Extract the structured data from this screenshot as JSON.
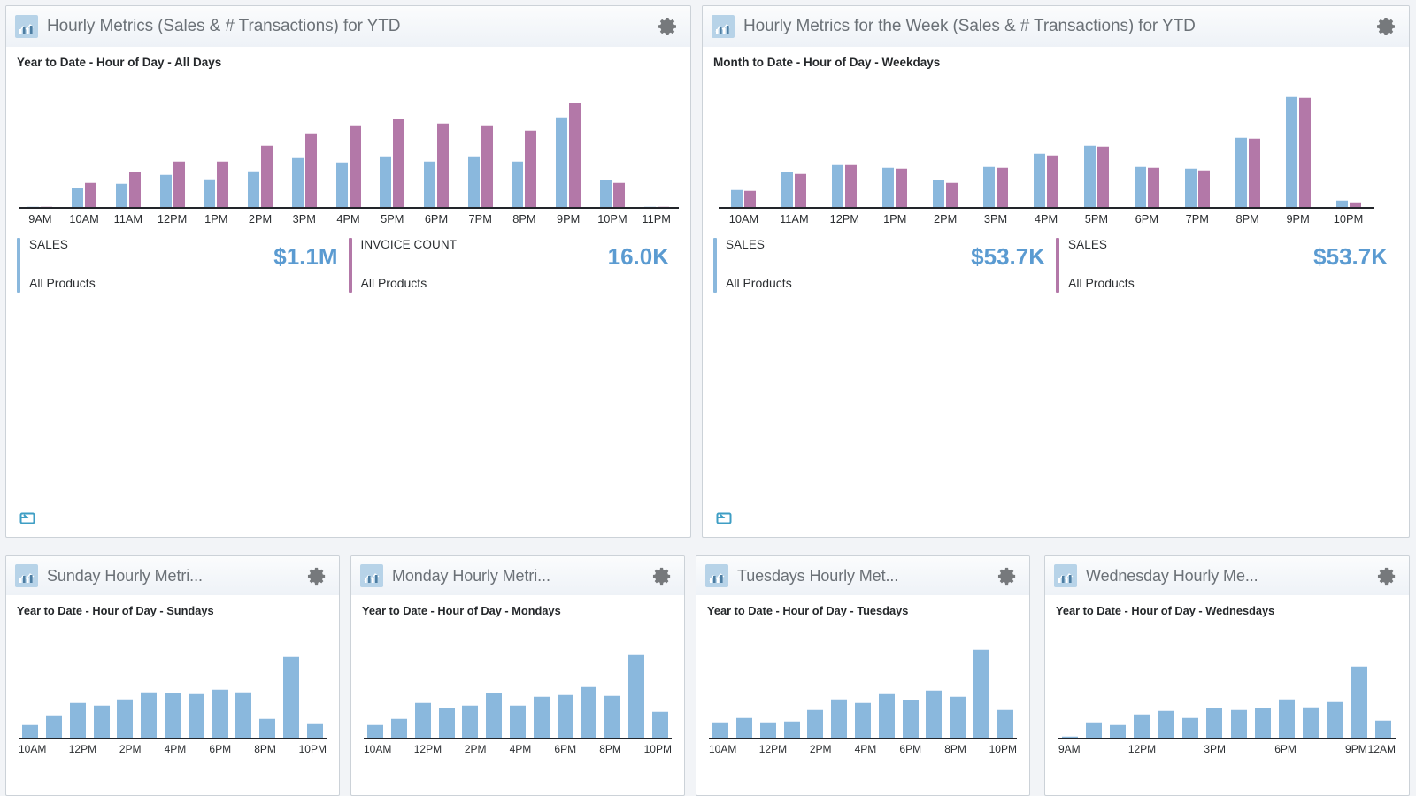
{
  "theme": {
    "series_blue": "#8ab8dd",
    "series_purple": "#b378a8",
    "kpi_value_color": "#5b9bd1",
    "panel_border": "#ccd2d8",
    "page_background": "#f2f4f7",
    "title_color": "#6b7177"
  },
  "panels": [
    {
      "id": "hourly-metrics-ytd",
      "icon": "bar-chart-icon",
      "gear": "gear-icon",
      "title": "Hourly Metrics (Sales & # Transactions) for YTD",
      "subtitle": "Year to Date - Hour of Day - All Days",
      "resize_handle": "resize-handle-icon",
      "kpis": [
        {
          "label": "SALES",
          "sub": "All Products",
          "value": "$1.1M",
          "accent": "#8ab8dd"
        },
        {
          "label": "INVOICE COUNT",
          "sub": "All Products",
          "value": "16.0K",
          "accent": "#b378a8"
        }
      ]
    },
    {
      "id": "hourly-metrics-week-ytd",
      "icon": "bar-chart-icon",
      "gear": "gear-icon",
      "title": "Hourly Metrics for the Week (Sales & # Transactions) for YTD",
      "subtitle": "Month to Date - Hour of Day - Weekdays",
      "resize_handle": "resize-handle-icon",
      "kpis": [
        {
          "label": "SALES",
          "sub": "All Products",
          "value": "$53.7K",
          "accent": "#8ab8dd"
        },
        {
          "label": "SALES",
          "sub": "All Products",
          "value": "$53.7K",
          "accent": "#b378a8"
        }
      ]
    },
    {
      "id": "sunday-hourly-metrics",
      "icon": "bar-chart-icon",
      "gear": "gear-icon",
      "title": "Sunday Hourly Metri...",
      "subtitle": "Year to Date - Hour of Day - Sundays",
      "kpis": []
    },
    {
      "id": "monday-hourly-metrics",
      "icon": "bar-chart-icon",
      "gear": "gear-icon",
      "title": "Monday Hourly Metri...",
      "subtitle": "Year to Date - Hour of Day - Mondays",
      "kpis": []
    },
    {
      "id": "tuesdays-hourly-metrics",
      "icon": "bar-chart-icon",
      "gear": "gear-icon",
      "title": "Tuesdays Hourly Met...",
      "subtitle": "Year to Date - Hour of Day - Tuesdays",
      "kpis": []
    },
    {
      "id": "wednesday-hourly-metrics",
      "icon": "bar-chart-icon",
      "gear": "gear-icon",
      "title": "Wednesday Hourly Me...",
      "subtitle": "Year to Date - Hour of Day - Wednesdays",
      "kpis": []
    }
  ],
  "chart_data": [
    {
      "id": "hourly-metrics-ytd",
      "type": "bar",
      "title": "Year to Date - Hour of Day - All Days",
      "xlabel": "Hour of Day",
      "ylabel": "",
      "grid": false,
      "legend_position": "below",
      "categories": [
        "9AM",
        "10AM",
        "11AM",
        "12PM",
        "1PM",
        "2PM",
        "3PM",
        "4PM",
        "5PM",
        "6PM",
        "7PM",
        "8PM",
        "9PM",
        "10PM",
        "11PM"
      ],
      "tick_labels": [
        "9AM",
        "10AM",
        "11AM",
        "12PM",
        "1PM",
        "2PM",
        "3PM",
        "4PM",
        "5PM",
        "6PM",
        "7PM",
        "8PM",
        "9PM",
        "10PM",
        "11PM"
      ],
      "ylim": [
        0,
        100
      ],
      "series": [
        {
          "name": "SALES",
          "color": "#8ab8dd",
          "values": [
            0,
            17,
            21,
            29,
            25,
            32,
            44,
            40,
            45,
            41,
            45,
            41,
            80,
            24,
            0
          ]
        },
        {
          "name": "INVOICE COUNT",
          "color": "#b378a8",
          "values": [
            0,
            22,
            31,
            41,
            41,
            55,
            66,
            73,
            78,
            74,
            73,
            68,
            92,
            22,
            0
          ]
        }
      ]
    },
    {
      "id": "hourly-metrics-week-ytd",
      "type": "bar",
      "title": "Month to Date - Hour of Day - Weekdays",
      "xlabel": "Hour of Day",
      "ylabel": "",
      "grid": false,
      "legend_position": "below",
      "categories": [
        "10AM",
        "11AM",
        "12PM",
        "1PM",
        "2PM",
        "3PM",
        "4PM",
        "5PM",
        "6PM",
        "7PM",
        "8PM",
        "9PM",
        "10PM"
      ],
      "tick_labels": [
        "10AM",
        "11AM",
        "12PM",
        "1PM",
        "2PM",
        "3PM",
        "4PM",
        "5PM",
        "6PM",
        "7PM",
        "8PM",
        "9PM",
        "10PM"
      ],
      "ylim": [
        0,
        100
      ],
      "series": [
        {
          "name": "SALES",
          "color": "#8ab8dd",
          "values": [
            16,
            31,
            38,
            35,
            24,
            36,
            48,
            55,
            36,
            34,
            62,
            98,
            6
          ]
        },
        {
          "name": "SALES",
          "color": "#b378a8",
          "values": [
            15,
            30,
            38,
            34,
            22,
            35,
            46,
            54,
            35,
            33,
            61,
            97,
            5
          ]
        }
      ]
    },
    {
      "id": "sunday-hourly-metrics",
      "type": "bar",
      "title": "Year to Date - Hour of Day - Sundays",
      "xlabel": "Hour of Day",
      "ylabel": "",
      "grid": false,
      "legend_position": "none",
      "categories": [
        "10AM",
        "11AM",
        "12PM",
        "1PM",
        "2PM",
        "3PM",
        "4PM",
        "5PM",
        "6PM",
        "7PM",
        "8PM",
        "9PM",
        "10PM"
      ],
      "tick_labels": [
        "10AM",
        "",
        "12PM",
        "",
        "2PM",
        "",
        "4PM",
        "",
        "6PM",
        "",
        "8PM",
        "",
        "10PM"
      ],
      "ylim": [
        0,
        100
      ],
      "series": [
        {
          "name": "SALES",
          "color": "#8ab8dd",
          "values": [
            14,
            25,
            38,
            36,
            42,
            50,
            49,
            48,
            53,
            50,
            21,
            88,
            15
          ]
        }
      ]
    },
    {
      "id": "monday-hourly-metrics",
      "type": "bar",
      "title": "Year to Date - Hour of Day - Mondays",
      "xlabel": "Hour of Day",
      "ylabel": "",
      "grid": false,
      "legend_position": "none",
      "categories": [
        "10AM",
        "11AM",
        "12PM",
        "1PM",
        "2PM",
        "3PM",
        "4PM",
        "5PM",
        "6PM",
        "7PM",
        "8PM",
        "9PM",
        "10PM"
      ],
      "tick_labels": [
        "10AM",
        "",
        "12PM",
        "",
        "2PM",
        "",
        "4PM",
        "",
        "6PM",
        "",
        "8PM",
        "",
        "10PM"
      ],
      "ylim": [
        0,
        100
      ],
      "series": [
        {
          "name": "SALES",
          "color": "#8ab8dd",
          "values": [
            14,
            21,
            38,
            33,
            36,
            49,
            36,
            45,
            47,
            56,
            46,
            90,
            29
          ]
        }
      ]
    },
    {
      "id": "tuesdays-hourly-metrics",
      "type": "bar",
      "title": "Year to Date - Hour of Day - Tuesdays",
      "xlabel": "Hour of Day",
      "ylabel": "",
      "grid": false,
      "legend_position": "none",
      "categories": [
        "10AM",
        "11AM",
        "12PM",
        "1PM",
        "2PM",
        "3PM",
        "4PM",
        "5PM",
        "6PM",
        "7PM",
        "8PM",
        "9PM",
        "10PM"
      ],
      "tick_labels": [
        "10AM",
        "",
        "12PM",
        "",
        "2PM",
        "",
        "4PM",
        "",
        "6PM",
        "",
        "8PM",
        "",
        "10PM"
      ],
      "ylim": [
        0,
        100
      ],
      "series": [
        {
          "name": "SALES",
          "color": "#8ab8dd",
          "values": [
            17,
            22,
            17,
            18,
            31,
            42,
            38,
            48,
            41,
            52,
            45,
            96,
            31
          ]
        }
      ]
    },
    {
      "id": "wednesday-hourly-metrics",
      "type": "bar",
      "title": "Year to Date - Hour of Day - Wednesdays",
      "xlabel": "Hour of Day",
      "ylabel": "",
      "grid": false,
      "legend_position": "none",
      "categories": [
        "9AM",
        "10AM",
        "11AM",
        "12PM",
        "1PM",
        "2PM",
        "3PM",
        "4PM",
        "5PM",
        "6PM",
        "7PM",
        "8PM",
        "9PM",
        "10PM"
      ],
      "tick_labels": [
        "9AM",
        "",
        "",
        "12PM",
        "",
        "",
        "3PM",
        "",
        "",
        "6PM",
        "",
        "",
        "9PM",
        "12AM"
      ],
      "ylim": [
        0,
        100
      ],
      "series": [
        {
          "name": "SALES",
          "color": "#8ab8dd",
          "values": [
            2,
            17,
            14,
            26,
            30,
            22,
            33,
            31,
            33,
            42,
            34,
            39,
            78,
            19
          ]
        }
      ]
    }
  ]
}
